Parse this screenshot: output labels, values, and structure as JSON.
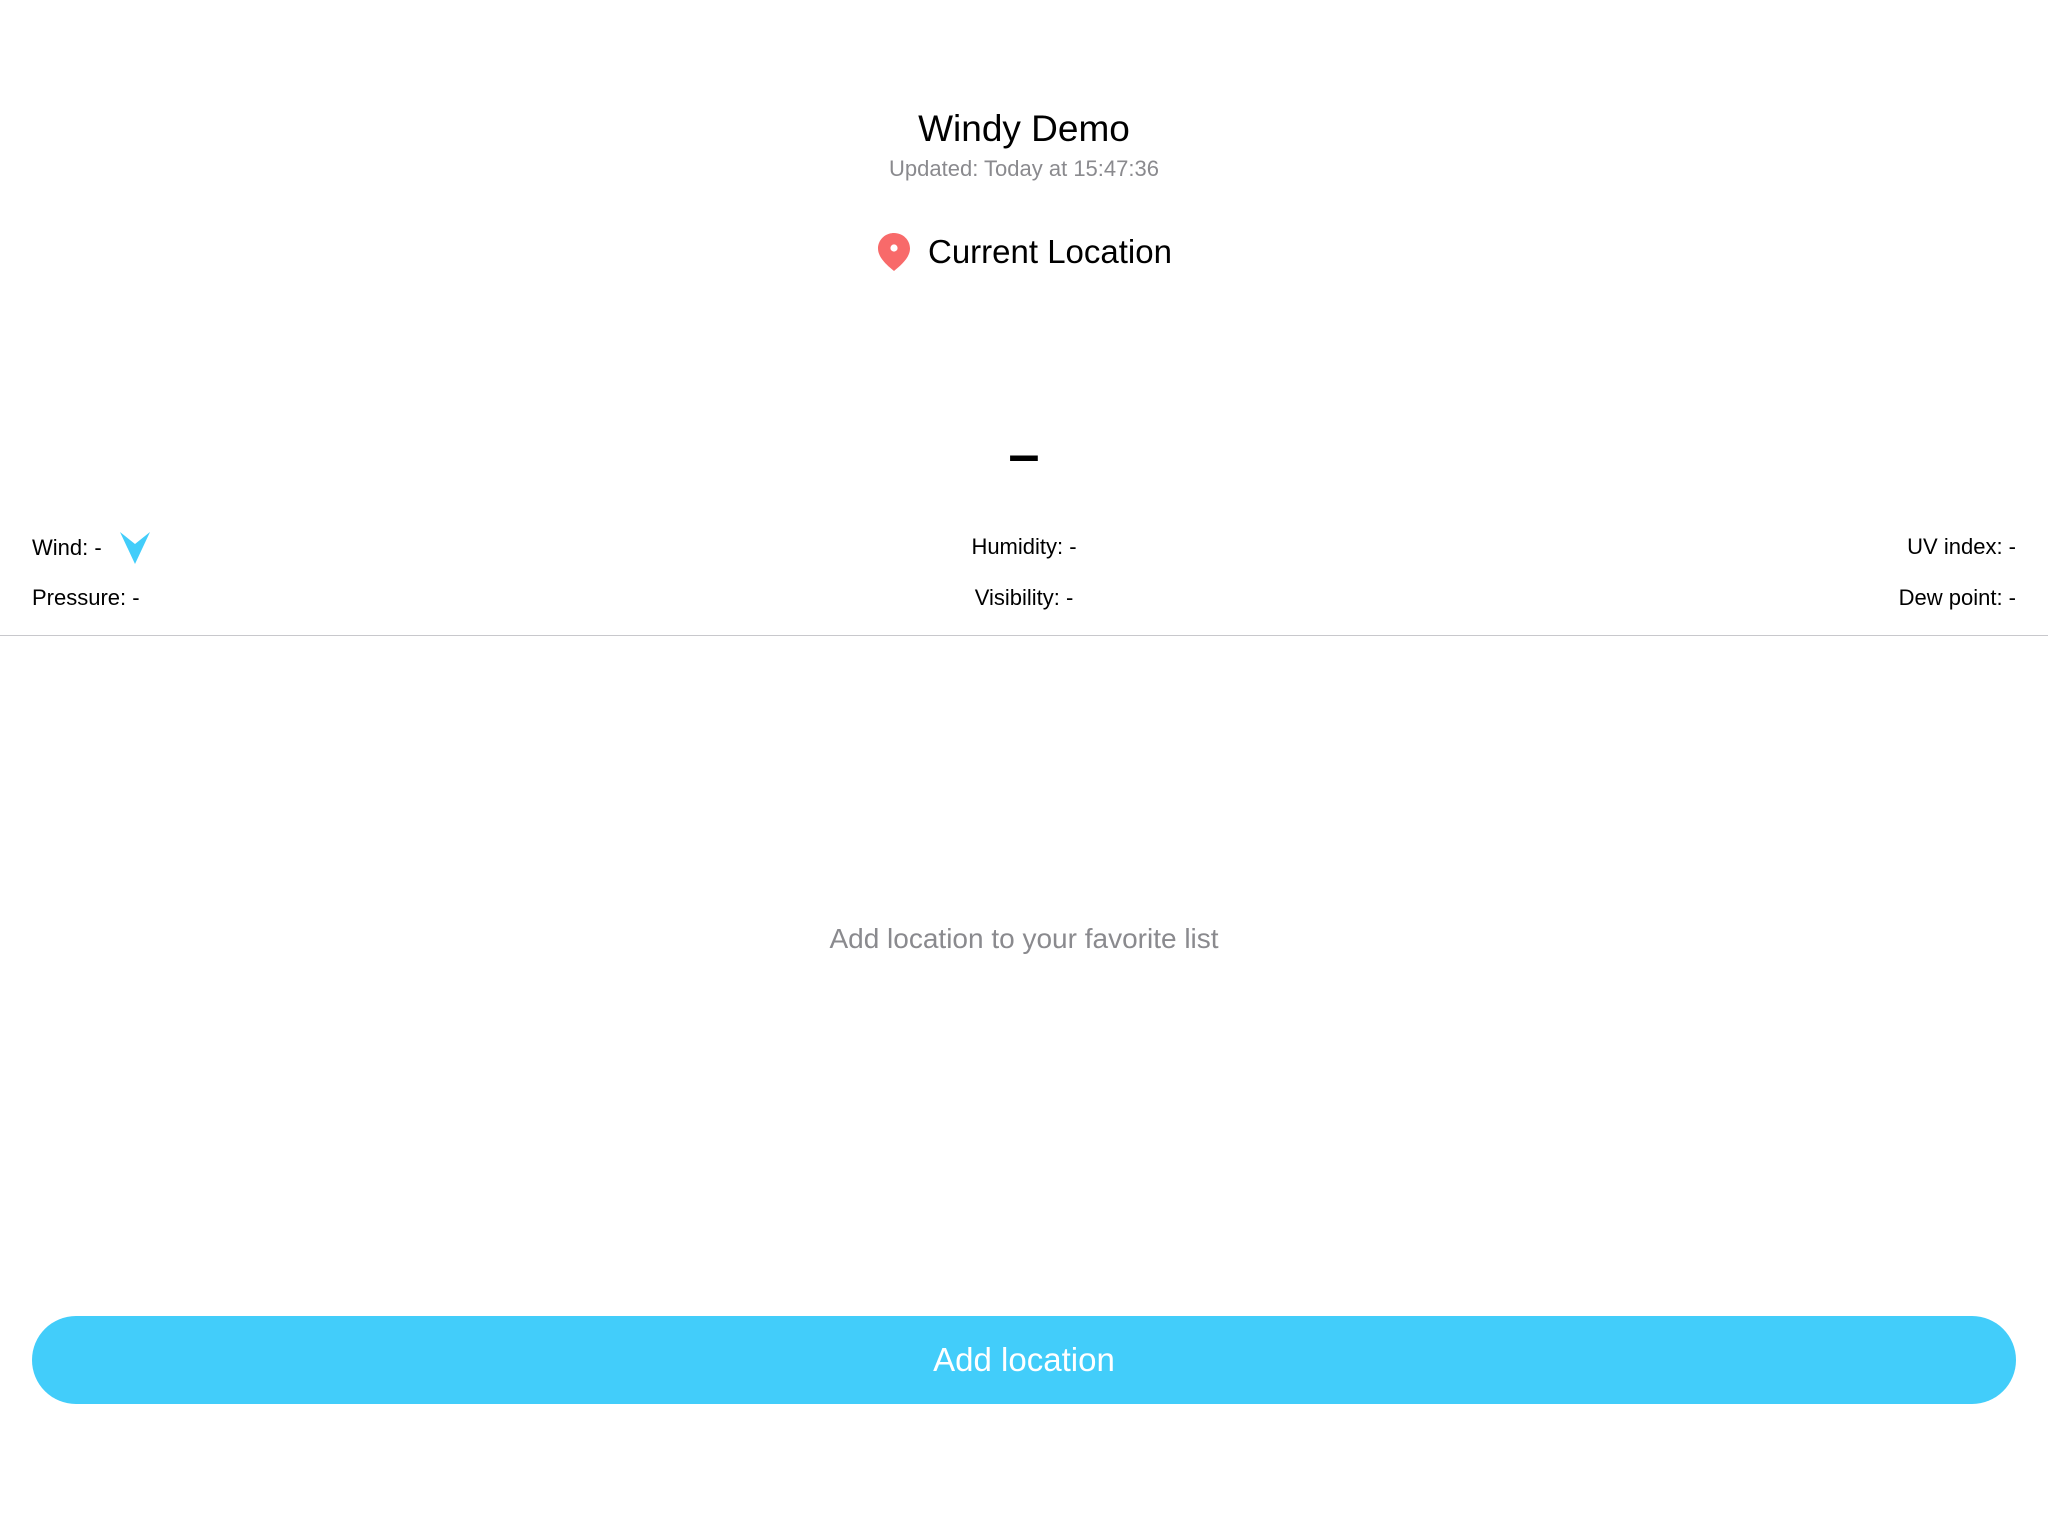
{
  "header": {
    "title": "Windy Demo",
    "updated": "Updated: Today at 15:47:36"
  },
  "location": {
    "icon": "map-pin-icon",
    "label": "Current Location",
    "icon_color": "#f86a6a"
  },
  "current": {
    "temperature": "–"
  },
  "stats": {
    "wind": "Wind: -",
    "wind_icon": "wind-direction-arrow-icon",
    "humidity": "Humidity: -",
    "uv_index": "UV index: -",
    "pressure": "Pressure: -",
    "visibility": "Visibility: -",
    "dew_point": "Dew point: -"
  },
  "favorites": {
    "empty_message": "Add location to your favorite list"
  },
  "actions": {
    "add_location_label": "Add location"
  },
  "colors": {
    "accent": "#42cdfa",
    "secondary_text": "#8a8a8e",
    "pin": "#f86a6a"
  }
}
